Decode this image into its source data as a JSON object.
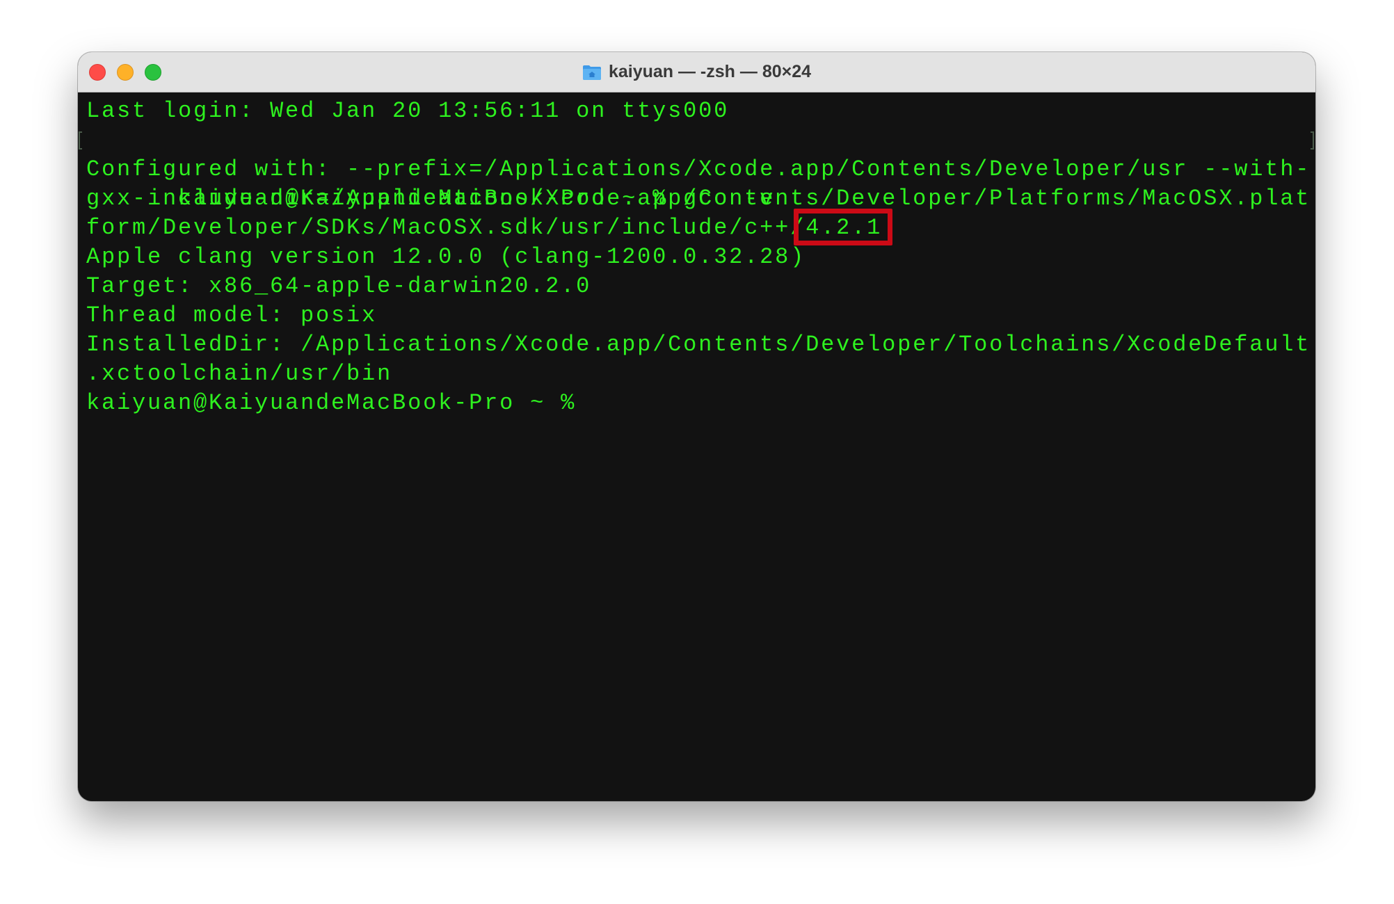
{
  "window": {
    "title": "kaiyuan — -zsh — 80×24",
    "title_icon": "home-folder-icon"
  },
  "traffic_lights": {
    "close": "close-window-button",
    "minimize": "minimize-window-button",
    "zoom": "zoom-window-button"
  },
  "terminal": {
    "lines": [
      "Last login: Wed Jan 20 13:56:11 on ttys000",
      "kaiyuan@KaiyuandeMacBook-Pro ~ % gcc -v",
      "Configured with: --prefix=/Applications/Xcode.app/Contents/Developer/usr --with-",
      "gxx-include-dir=/Applications/Xcode.app/Contents/Developer/Platforms/MacOSX.plat",
      "form/Developer/SDKs/MacOSX.sdk/usr/include/c++/4.2.1",
      "Apple clang version 12.0.0 (clang-1200.0.32.28)",
      "Target: x86_64-apple-darwin20.2.0",
      "Thread model: posix",
      "InstalledDir: /Applications/Xcode.app/Contents/Developer/Toolchains/XcodeDefault",
      ".xctoolchain/usr/bin",
      "kaiyuan@KaiyuandeMacBook-Pro ~ % "
    ],
    "highlighted_text": "4.2.1",
    "colors": {
      "foreground": "#2ef21f",
      "background": "#121212",
      "highlight_box": "#cc0a16"
    }
  }
}
